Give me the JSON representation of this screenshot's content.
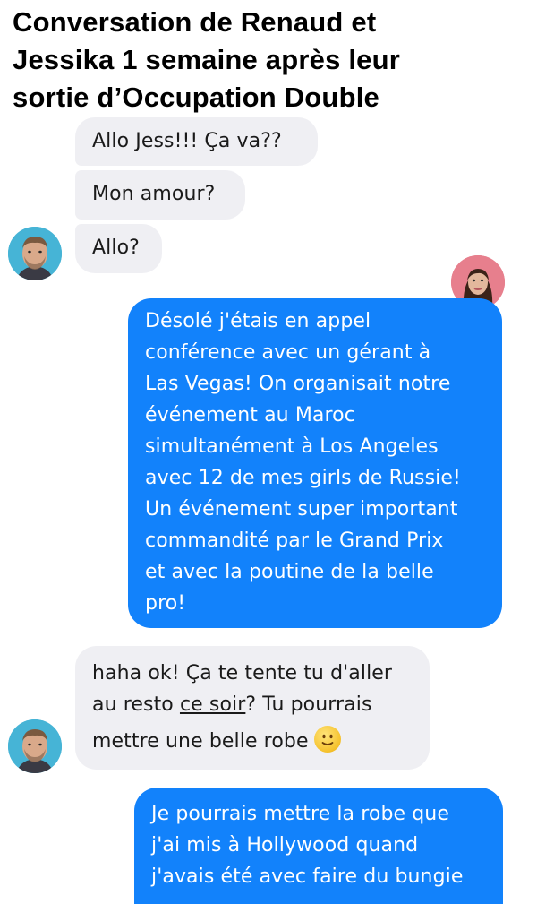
{
  "title": {
    "line1": "Conversation de Renaud et",
    "line2": "Jessika 1 semaine après leur",
    "line3": "sortie d’Occupation Double"
  },
  "messages": [
    {
      "from": "renaud",
      "lines": [
        "Allo Jess!!! Ça va??"
      ]
    },
    {
      "from": "renaud",
      "lines": [
        "Mon amour?"
      ]
    },
    {
      "from": "renaud",
      "lines": [
        "Allo?"
      ]
    },
    {
      "from": "jessika",
      "lines": [
        "Désolé j'étais en appel",
        "conférence avec un gérant à",
        "Las Vegas! On organisait notre",
        "événement au Maroc",
        "simultanément à Los Angeles",
        "avec 12 de mes girls de Russie!",
        "Un événement super important",
        "commandité par le Grand Prix",
        "et avec la poutine de la belle",
        "pro!"
      ]
    },
    {
      "from": "renaud",
      "lines": [
        "haha ok! Ça te tente tu d'aller",
        "au resto ",
        "ce soir",
        "? Tu pourrais",
        "mettre une belle robe"
      ],
      "emoji": "slightly-smiling-face"
    },
    {
      "from": "jessika",
      "lines": [
        "Je pourrais mettre la robe que",
        "j'ai mis à Hollywood quand",
        "j'avais été avec faire du bungie"
      ]
    }
  ],
  "colors": {
    "incoming_bubble": "#efeff3",
    "outgoing_bubble": "#1282fb",
    "renaud_avatar_bg": "#46b4d6",
    "jessika_avatar_bg": "#e77f8d"
  }
}
